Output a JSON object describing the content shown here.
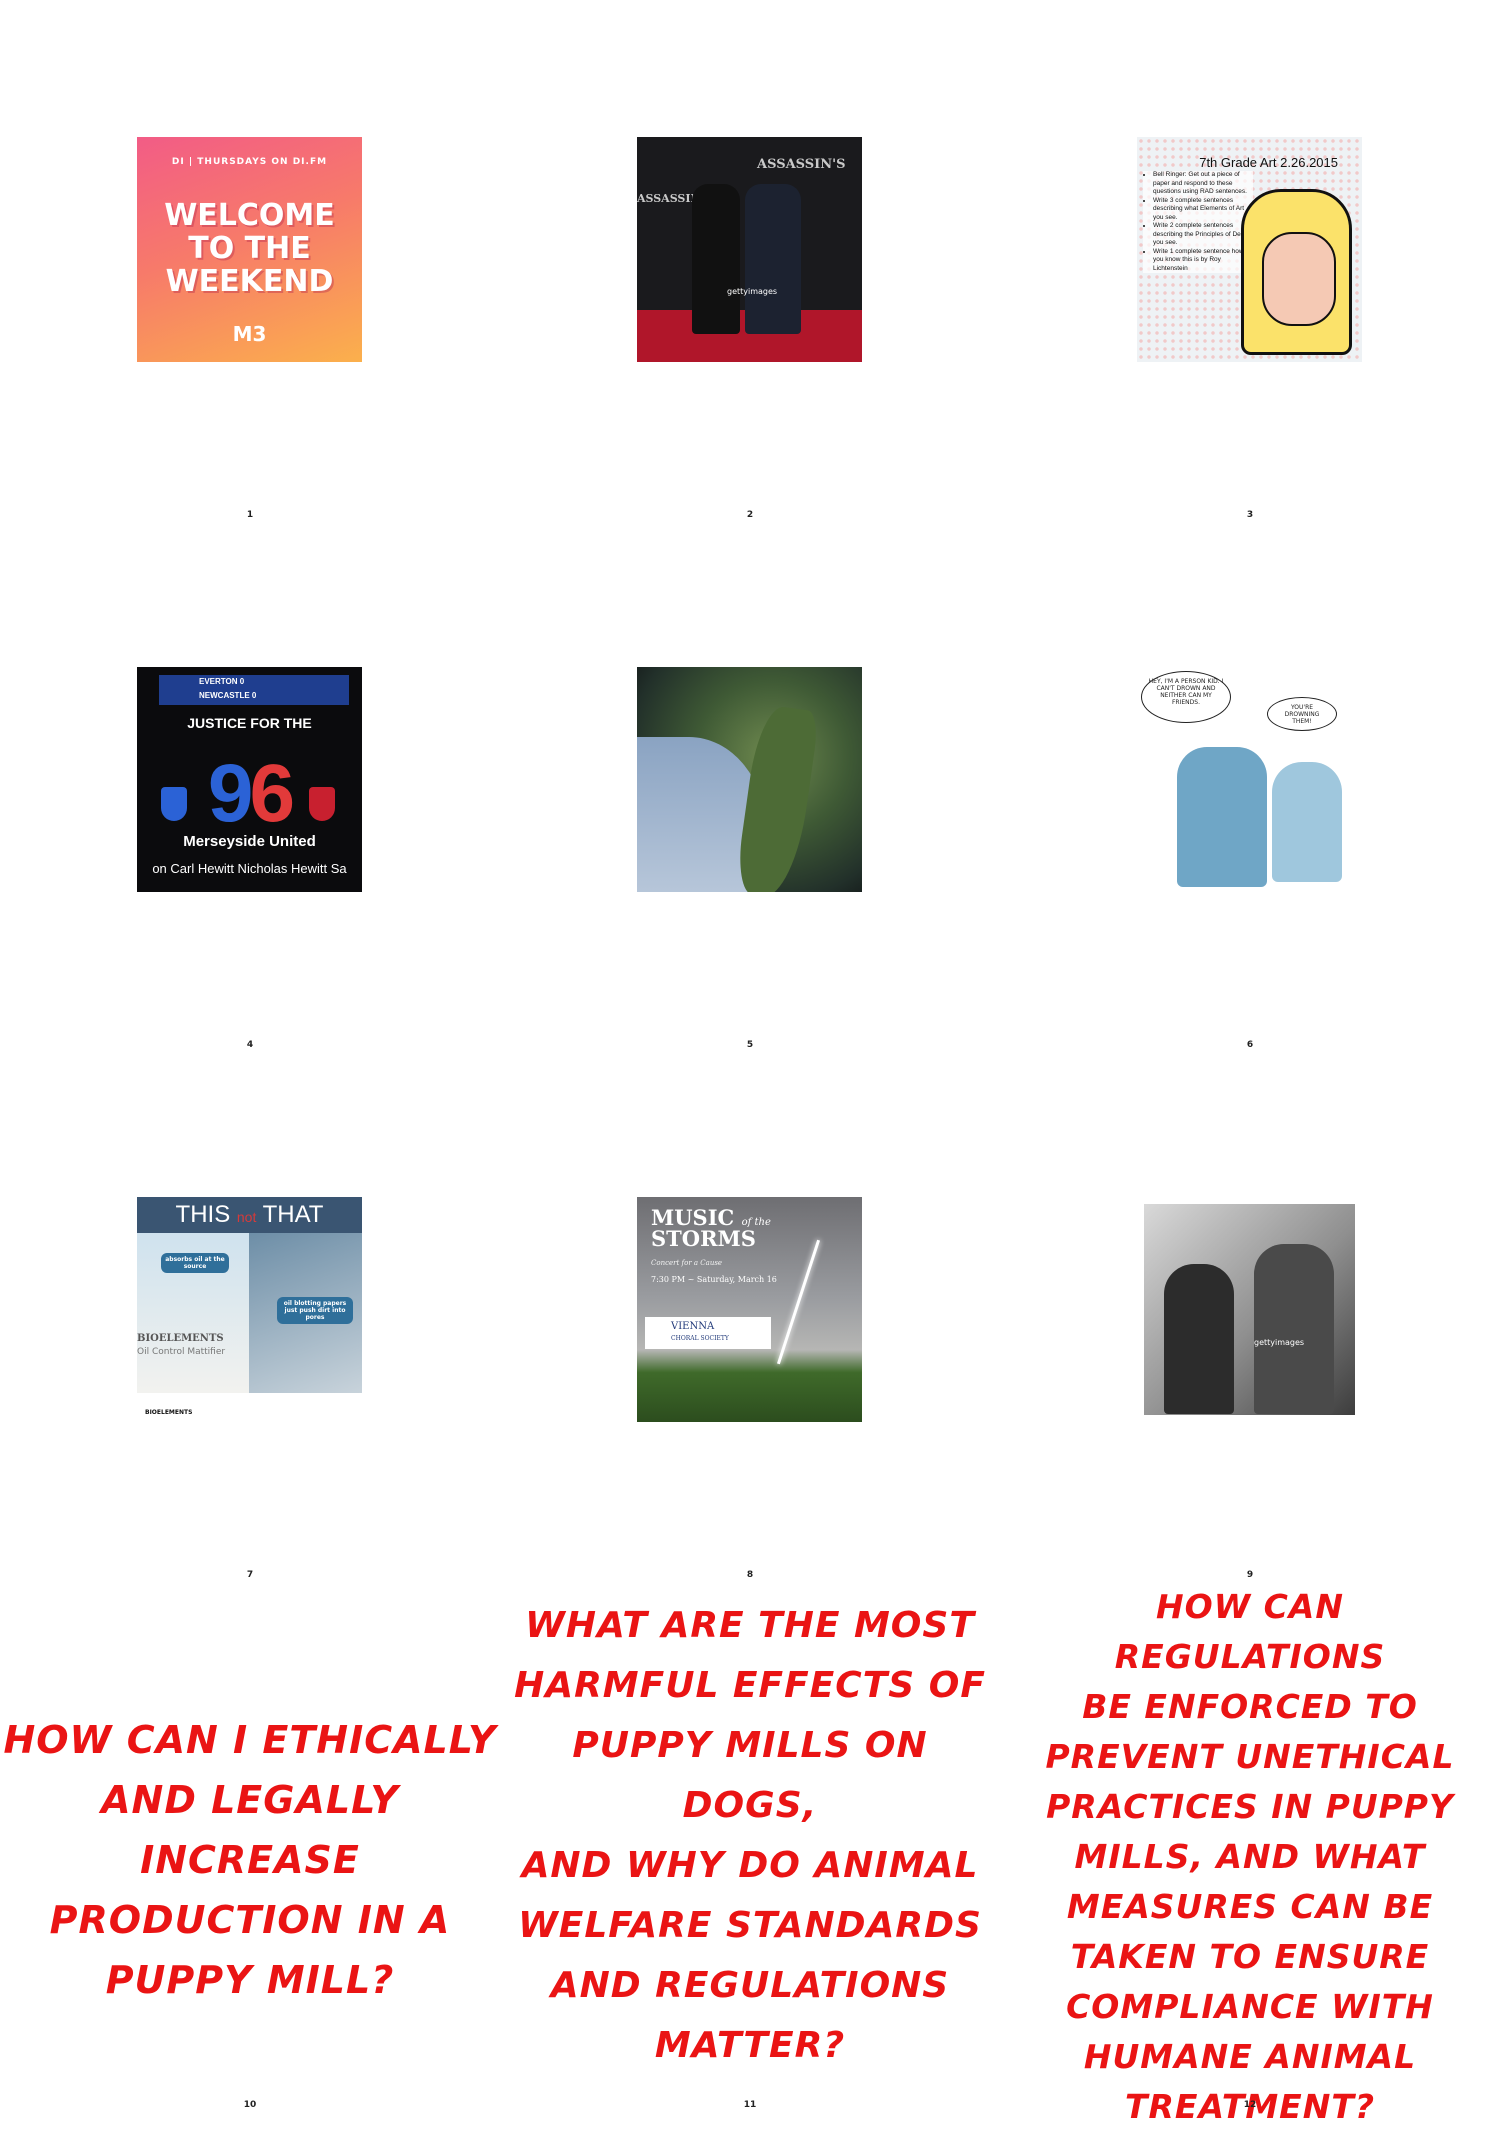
{
  "tiles": [
    {
      "number": "1",
      "top_text": "DI | THURSDAYS ON DI.FM",
      "headline_lines": [
        "WELCOME",
        "TO THE",
        "WEEKEND"
      ],
      "logo_text": "M3"
    },
    {
      "number": "2",
      "brand_text": "ASSASSIN'S",
      "credit_text": "gettyimages"
    },
    {
      "number": "3",
      "title": "7th Grade Art 2.26.2015",
      "bullets": [
        "Bell Ringer: Get out a piece of paper and respond to these questions using RAD sentences.",
        "Write 3 complete sentences describing what Elements of Art you see.",
        "Write 2 complete sentences describing the Principles of Design you see.",
        "Write 1 complete sentence how you know this is by Roy Lichtenstein"
      ]
    },
    {
      "number": "4",
      "score_rows": [
        "EVERTON 0",
        "NEWCASTLE 0"
      ],
      "headline": "JUSTICE FOR THE",
      "big_number_a": "9",
      "big_number_b": "6",
      "subline": "Merseyside United",
      "names": "on  Carl Hewitt  Nicholas Hewitt  Sa"
    },
    {
      "number": "5"
    },
    {
      "number": "6",
      "speech_1": "HEY, I'M A PERSON KID. I CAN'T DROWN AND NEITHER CAN MY FRIENDS.",
      "speech_2": "YOU'RE DROWNING THEM!"
    },
    {
      "number": "7",
      "band_left": "THIS",
      "band_mid": "not",
      "band_right": "THAT",
      "label_1": "absorbs oil at the source",
      "label_2": "oil blotting papers just push dirt into pores",
      "product": "BIOELEMENTS",
      "product_sub": "Oil Control Mattifier",
      "footer": "BIOELEMENTS"
    },
    {
      "number": "8",
      "title_1": "MUSIC",
      "title_of": "of the",
      "title_2": "STORMS",
      "subtitle": "Concert for a Cause",
      "date": "7:30 PM ~ Saturday, March 16",
      "org_1": "VIENNA",
      "org_2": "CHORAL SOCIETY"
    },
    {
      "number": "9",
      "credit_text": "gettyimages"
    }
  ],
  "questions": [
    {
      "number": "10",
      "lines": [
        "How can I ethically",
        "and legally increase",
        "production in a",
        "puppy mill?"
      ]
    },
    {
      "number": "11",
      "lines": [
        "What are the most",
        "harmful effects of",
        "puppy mills on dogs,",
        "and why do animal",
        "welfare standards",
        "and regulations",
        "matter?"
      ]
    },
    {
      "number": "12",
      "lines": [
        "How can regulations",
        "be enforced to",
        "prevent unethical",
        "practices in puppy",
        "mills, and what",
        "measures can be",
        "taken to ensure",
        "compliance with",
        "humane animal",
        "treatment?"
      ]
    }
  ],
  "colors": {
    "question_red": "#ea1414",
    "background": "#ffffff"
  }
}
